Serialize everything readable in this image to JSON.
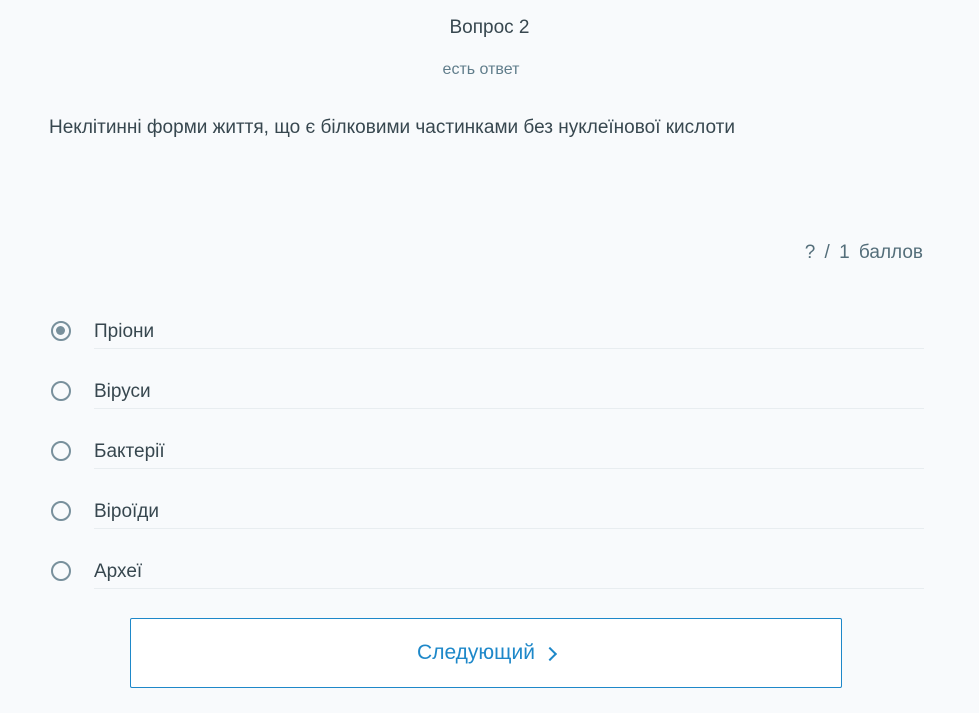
{
  "header": {
    "title": "Вопрос 2",
    "status": "есть ответ"
  },
  "question": {
    "text": "Неклітинні форми життя, що є білковими частинками без нуклеїнової кислоти",
    "points": "? / 1 баллов"
  },
  "options": [
    {
      "label": "Пріони",
      "selected": true
    },
    {
      "label": "Віруси",
      "selected": false
    },
    {
      "label": "Бактерії",
      "selected": false
    },
    {
      "label": "Віроїди",
      "selected": false
    },
    {
      "label": "Археї",
      "selected": false
    }
  ],
  "next_button": {
    "label": "Следующий",
    "icon": "chevron-right-icon"
  },
  "colors": {
    "accent": "#1e88c9",
    "radio": "#78909c",
    "background": "#f8fafc"
  }
}
